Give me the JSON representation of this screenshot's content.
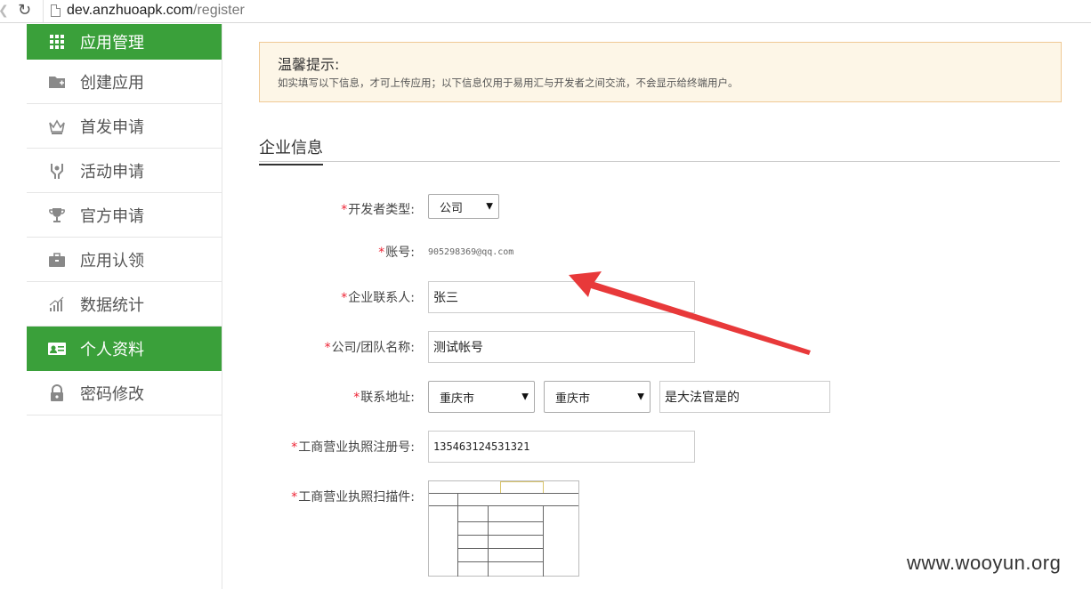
{
  "browser": {
    "back_glyph": "❮",
    "reload_glyph": "↻",
    "url_host": "dev.anzhuoapk.com",
    "url_path": "/register"
  },
  "sidebar": {
    "items": [
      {
        "label": "应用管理",
        "icon": "grid-icon",
        "active": true
      },
      {
        "label": "创建应用",
        "icon": "folder-icon",
        "active": false
      },
      {
        "label": "首发申请",
        "icon": "crown-icon",
        "active": false
      },
      {
        "label": "活动申请",
        "icon": "hands-icon",
        "active": false
      },
      {
        "label": "官方申请",
        "icon": "trophy-icon",
        "active": false
      },
      {
        "label": "应用认领",
        "icon": "briefcase-icon",
        "active": false
      },
      {
        "label": "数据统计",
        "icon": "bar-chart-icon",
        "active": false
      },
      {
        "label": "个人资料",
        "icon": "id-card-icon",
        "active": true
      },
      {
        "label": "密码修改",
        "icon": "lock-icon",
        "active": false
      }
    ]
  },
  "notice": {
    "title": "温馨提示:",
    "text": "如实填写以下信息，才可上传应用；以下信息仅用于易用汇与开发者之间交流，不会显示给终端用户。"
  },
  "section": {
    "title": "企业信息"
  },
  "form": {
    "developer_type": {
      "label": "开发者类型:",
      "value": "公司"
    },
    "account": {
      "label": "账号:",
      "value": "905298369@qq.com"
    },
    "contact": {
      "label": "企业联系人:",
      "value": "张三"
    },
    "company_name": {
      "label": "公司/团队名称:",
      "value": "测试帐号"
    },
    "address": {
      "label": "联系地址:",
      "province": "重庆市",
      "city": "重庆市",
      "detail": "是大法官是的"
    },
    "license_no": {
      "label": "工商营业执照注册号:",
      "value": "135463124531321"
    },
    "license_scan": {
      "label": "工商营业执照扫描件:"
    }
  },
  "required_mark": "*",
  "select_caret": "▼",
  "watermark": "www.wooyun.org",
  "colors": {
    "sidebar_active": "#3aa03a",
    "notice_bg": "#fdf6e7",
    "notice_border": "#f0c995",
    "required": "#e23",
    "arrow": "#e8393a"
  }
}
